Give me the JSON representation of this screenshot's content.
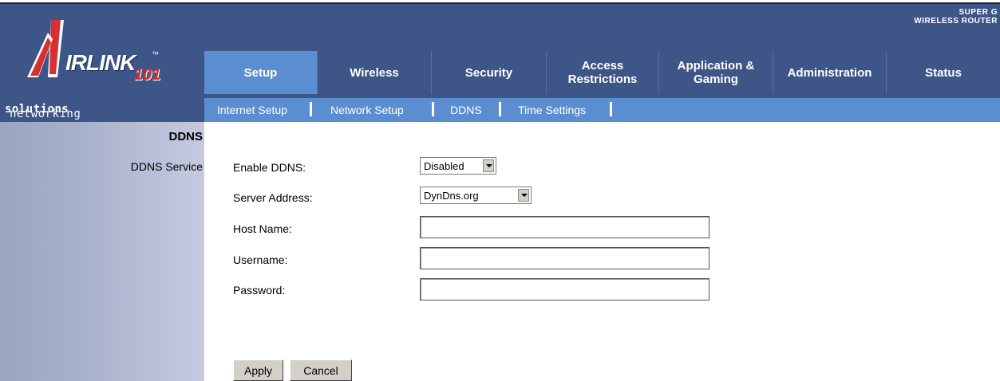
{
  "logo": {
    "word": "IRLINK",
    "tm": "™",
    "number": "101"
  },
  "tagline": {
    "light": "networking",
    "bold": "solutions"
  },
  "brand": {
    "line1": "SUPER G",
    "line2": "WIRELESS ROUTER"
  },
  "tabs": [
    {
      "label": "Setup"
    },
    {
      "label": "Wireless"
    },
    {
      "label": "Security"
    },
    {
      "label": "Access Restrictions"
    },
    {
      "label": "Application & Gaming"
    },
    {
      "label": "Administration"
    },
    {
      "label": "Status"
    }
  ],
  "subnav": [
    {
      "label": "Internet Setup"
    },
    {
      "label": "Network Setup"
    },
    {
      "label": "DDNS"
    },
    {
      "label": "Time Settings"
    }
  ],
  "sidebar": {
    "title": "DDNS",
    "item": "DDNS Service"
  },
  "form": {
    "enable_ddns": {
      "label": "Enable DDNS:",
      "value": "Disabled"
    },
    "server_address": {
      "label": "Server Address:",
      "value": "DynDns.org"
    },
    "host_name": {
      "label": "Host Name:",
      "value": ""
    },
    "username": {
      "label": "Username:",
      "value": ""
    },
    "password": {
      "label": "Password:",
      "value": ""
    }
  },
  "buttons": {
    "apply": "Apply",
    "cancel": "Cancel"
  },
  "colors": {
    "header": "#3e5687",
    "accent": "#5b8ed0",
    "logo_red": "#d63030"
  }
}
